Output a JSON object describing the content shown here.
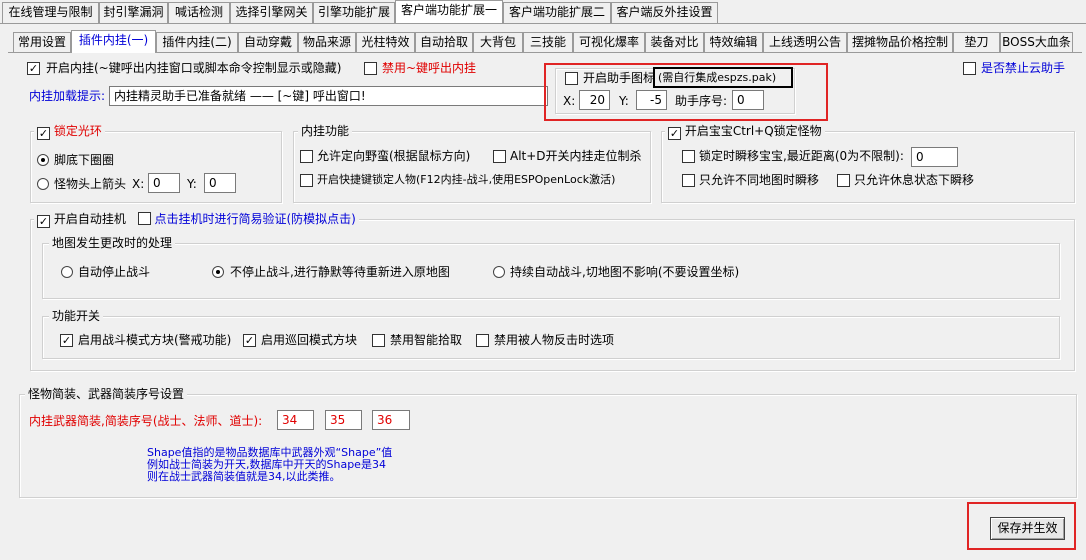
{
  "top_tabs": [
    "在线管理与限制",
    "封引擎漏洞",
    "喊话检测",
    "选择引擎网关",
    "引擎功能扩展",
    "客户端功能扩展一",
    "客户端功能扩展二",
    "客户端反外挂设置"
  ],
  "sub_tabs": [
    "常用设置",
    "插件内挂(一)",
    "插件内挂(二)",
    "自动穿戴",
    "物品来源",
    "光柱特效",
    "自动拾取",
    "大背包",
    "三技能",
    "可视化爆率",
    "装备对比",
    "特效编辑",
    "上线透明公告",
    "摆摊物品价格控制",
    "垫刀",
    "BOSS大血条"
  ],
  "enable_plugin": {
    "checked": true,
    "label": "开启内挂(~键呼出内挂窗口或脚本命令控制显示或隐藏)"
  },
  "disable_tilde": {
    "checked": false,
    "label": "禁用~键呼出内挂"
  },
  "load_prompt": {
    "label": "内挂加载提示:",
    "value": "内挂精灵助手已准备就绪 —— [~键] 呼出窗口!"
  },
  "helper_icon": {
    "checked": false,
    "label": "开启助手图标",
    "note": "(需自行集成espzs.pak)",
    "x_label": "X:",
    "x_value": "20",
    "y_label": "Y:",
    "y_value": "-5",
    "seq_label": "助手序号:",
    "seq_value": "0"
  },
  "cloud_helper": {
    "checked": false,
    "label": "是否禁止云助手"
  },
  "lock_halo": {
    "checked": true,
    "label": "锁定光环",
    "options": [
      {
        "label": "脚底下圈圈",
        "selected": true
      },
      {
        "label": "怪物头上箭头",
        "selected": false
      }
    ],
    "x_label": "X:",
    "x_value": "0",
    "y_label": "Y:",
    "y_value": "0"
  },
  "plugin_functions": {
    "title": "内挂功能",
    "items": [
      {
        "label": "允许定向野蛮(根据鼠标方向)",
        "checked": false
      },
      {
        "label": "Alt+D开关内挂走位制杀",
        "checked": false
      },
      {
        "label": "开启快捷键锁定人物(F12内挂-战斗,使用ESPOpenLock激活)",
        "checked": false
      }
    ]
  },
  "pet": {
    "checked": true,
    "label": "开启宝宝Ctrl+Q锁定怪物",
    "teleport_label": "锁定时瞬移宝宝,最近距离(0为不限制):",
    "teleport_value": "0",
    "teleport_checked": false,
    "same_map": {
      "label": "只允许不同地图时瞬移",
      "checked": false
    },
    "rest_only": {
      "label": "只允许休息状态下瞬移",
      "checked": false
    }
  },
  "auto_hang": {
    "checked": true,
    "label": "开启自动挂机"
  },
  "hang_verify": {
    "checked": false,
    "label": "点击挂机时进行简易验证(防模拟点击)"
  },
  "map_change": {
    "title": "地图发生更改时的处理",
    "options": [
      {
        "label": "自动停止战斗",
        "selected": false
      },
      {
        "label": "不停止战斗,进行静默等待重新进入原地图",
        "selected": true
      },
      {
        "label": "持续自动战斗,切地图不影响(不要设置坐标)",
        "selected": false
      }
    ]
  },
  "func_switch": {
    "title": "功能开关",
    "items": [
      {
        "label": "启用战斗模式方块(警戒功能)",
        "checked": true
      },
      {
        "label": "启用巡回模式方块",
        "checked": true
      },
      {
        "label": "禁用智能拾取",
        "checked": false
      },
      {
        "label": "禁用被人物反击时选项",
        "checked": false
      }
    ]
  },
  "weapon_shape": {
    "title": "怪物简装、武器简装序号设置",
    "label": "内挂武器简装,简装序号(战士、法师、道士):",
    "values": [
      "34",
      "35",
      "36"
    ],
    "note_lines": [
      "Shape值指的是物品数据库中武器外观“Shape”值",
      "例如战士简装为开天,数据库中开天的Shape是34",
      "则在战士武器简装值就是34,以此类推。"
    ]
  },
  "save_button": "保存并生效",
  "colors": {
    "red": "#e00000",
    "blue": "#0000d8",
    "highlight": "#e02424"
  }
}
